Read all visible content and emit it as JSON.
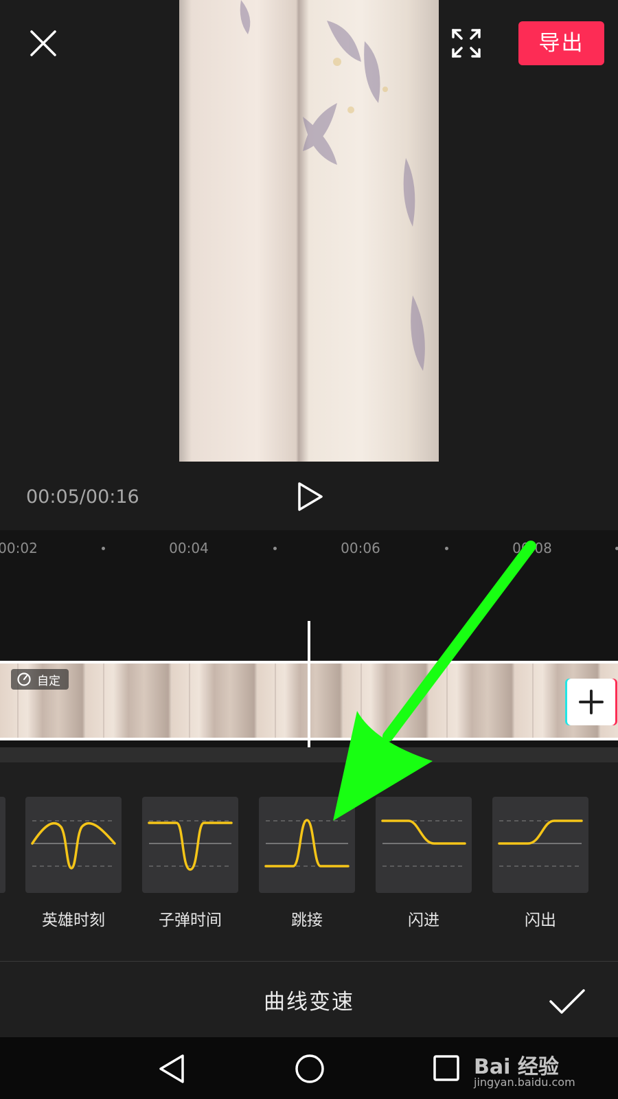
{
  "header": {
    "export_label": "导出",
    "close_icon": "close-icon",
    "fullscreen_icon": "fullscreen-icon",
    "export_color": "#fd2c55"
  },
  "player": {
    "time_display": "00:05/00:16",
    "play_icon": "play-icon"
  },
  "timeline": {
    "ticks": [
      "00:02",
      "00:04",
      "00:06",
      "00:08"
    ],
    "clip_badge": "自定",
    "add_icon": "plus-icon"
  },
  "presets": [
    {
      "label": "英雄时刻",
      "curve": "hero"
    },
    {
      "label": "子弹时间",
      "curve": "bullet"
    },
    {
      "label": "跳接",
      "curve": "jump"
    },
    {
      "label": "闪进",
      "curve": "flash-in"
    },
    {
      "label": "闪出",
      "curve": "flash-out"
    }
  ],
  "curve_color": "#f5c518",
  "footer": {
    "title": "曲线变速",
    "confirm_icon": "check-icon"
  },
  "navbar": [
    "back-icon",
    "home-icon",
    "recents-icon"
  ],
  "watermark": {
    "text": "Bai 经验",
    "url": "jingyan.baidu.com"
  },
  "annotation": {
    "arrow_color": "#18ff12"
  }
}
